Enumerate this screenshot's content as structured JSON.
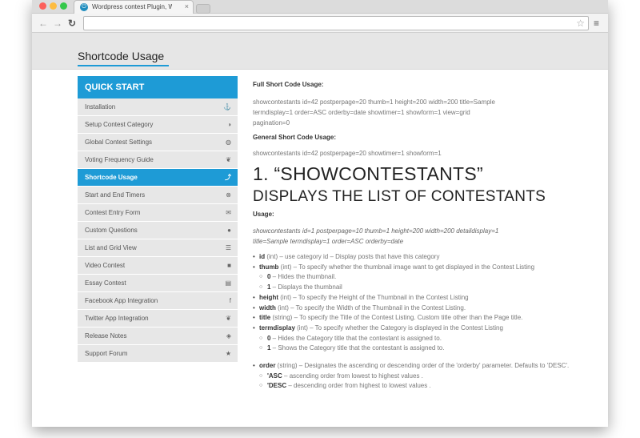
{
  "browser": {
    "tab_title": "Wordpress contest Plugin, W",
    "tab_close": "×",
    "back": "←",
    "forward": "→",
    "reload": "↻",
    "star": "☆",
    "menu": "≡",
    "url": ""
  },
  "header": {
    "title": "Shortcode Usage"
  },
  "sidebar": {
    "heading": "QUICK START",
    "items": [
      {
        "label": "Installation",
        "icon": "⚓",
        "icon_name": "anchor-icon"
      },
      {
        "label": "Setup Contest Category",
        "icon": "◑",
        "icon_name": "adjust-icon"
      },
      {
        "label": "Global Contest Settings",
        "icon": "◍",
        "icon_name": "globe-icon"
      },
      {
        "label": "Voting Frequency Guide",
        "icon": "❦",
        "icon_name": "leaf-icon"
      },
      {
        "label": "Shortcode Usage",
        "icon": "⤴",
        "icon_name": "share-icon"
      },
      {
        "label": "Start and End Timers",
        "icon": "⊗",
        "icon_name": "timer-icon"
      },
      {
        "label": "Contest Entry Form",
        "icon": "✉",
        "icon_name": "envelope-icon"
      },
      {
        "label": "Custom Questions",
        "icon": "●",
        "icon_name": "comment-icon"
      },
      {
        "label": "List and Grid View",
        "icon": "☰",
        "icon_name": "list-icon"
      },
      {
        "label": "Video Contest",
        "icon": "■",
        "icon_name": "video-icon"
      },
      {
        "label": "Essay Contest",
        "icon": "▤",
        "icon_name": "file-icon"
      },
      {
        "label": "Facebook App Integration",
        "icon": "f",
        "icon_name": "facebook-icon"
      },
      {
        "label": "Twitter App Integration",
        "icon": "❦",
        "icon_name": "twitter-icon"
      },
      {
        "label": "Release Notes",
        "icon": "◈",
        "icon_name": "shield-icon"
      },
      {
        "label": "Support Forum",
        "icon": "★",
        "icon_name": "star-icon"
      }
    ],
    "active_index": 4
  },
  "content": {
    "full_label": "Full Short Code Usage:",
    "full_line1": "showcontestants id=42 postperpage=20 thumb=1 height=200 width=200 title=Sample",
    "full_line2": "termdisplay=1 order=ASC orderby=date showtimer=1 showform=1 view=grid",
    "full_line3": "pagination=0",
    "general_label": "General Short Code Usage:",
    "general_line": "showcontestants id=42 postperpage=20 showtimer=1 showform=1",
    "h1": "1. “SHOWCONTESTANTS”",
    "h2": "DISPLAYS THE LIST OF CONTESTANTS",
    "usage_label": "Usage:",
    "usage_line1": "showcontestants id=1 postperpage=10 thumb=1 height=200 width=200 detaildisplay=1",
    "usage_line2": "title=Sample termdisplay=1 order=ASC orderby=date",
    "params": [
      {
        "type": "param",
        "name": "id",
        "desc": " (int) – use category id – Display posts that have this category"
      },
      {
        "type": "param",
        "name": "thumb",
        "desc": " (int) – To specify whether the thumbnail image want to get displayed in the Contest Listing"
      },
      {
        "type": "sub",
        "name": "0",
        "desc": " – Hides the thumbnail."
      },
      {
        "type": "sub",
        "name": "1",
        "desc": " – Displays the thumbnail"
      },
      {
        "type": "param",
        "name": "height",
        "desc": " (int) – To specify the Height of the Thumbnail in the Contest Listing"
      },
      {
        "type": "param",
        "name": "width",
        "desc": " (int) – To specify the Width of the Thumbnail in the Contest Listing."
      },
      {
        "type": "param",
        "name": "title",
        "desc": " (string) – To specify the Title of the Contest Listing. Custom title other than the Page title."
      },
      {
        "type": "param",
        "name": "termdisplay",
        "desc": " (int) – To specify whether the Category is displayed in the Contest Listing"
      },
      {
        "type": "sub",
        "name": "0",
        "desc": " – Hides the Category title that the contestant is assigned to."
      },
      {
        "type": "sub",
        "name": "1",
        "desc": " – Shows the Category title that the contestant is assigned to."
      }
    ],
    "order_params": [
      {
        "type": "param",
        "name": "order",
        "desc": " (string) – Designates the ascending or descending order of the 'orderby' parameter. Defaults to 'DESC'."
      },
      {
        "type": "sub",
        "name": "'ASC",
        "desc": " – ascending order from lowest to highest values ."
      },
      {
        "type": "sub",
        "name": "'DESC",
        "desc": " – descending order from highest to lowest values ."
      }
    ]
  }
}
